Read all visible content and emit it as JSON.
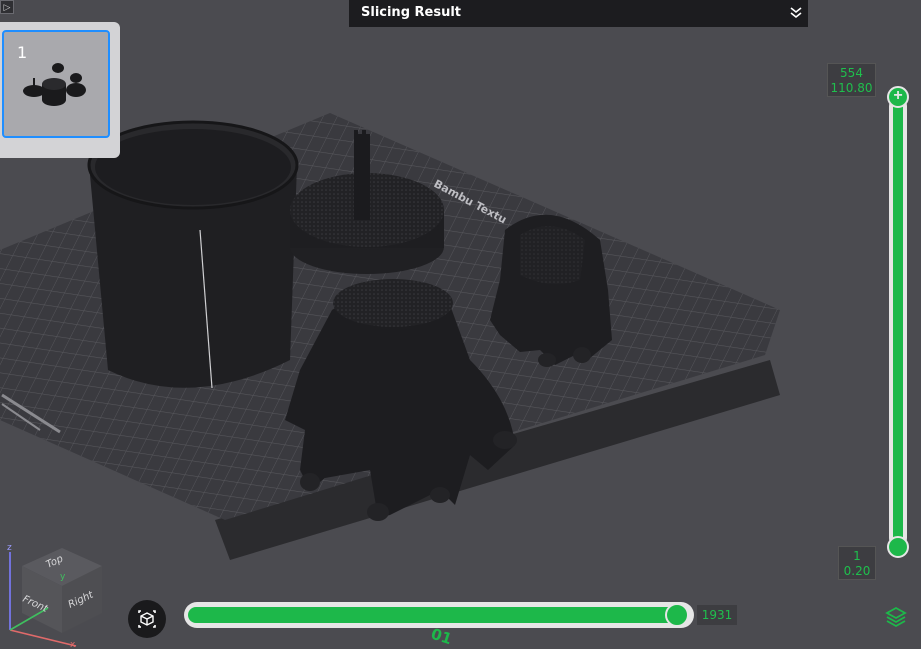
{
  "top_bar": {
    "title": "Slicing Result"
  },
  "plate": {
    "number": "1"
  },
  "bed": {
    "label": "Bambu Textu",
    "bottom_marker": "01"
  },
  "vertical_slider": {
    "top_layer": "554",
    "top_height": "110.80",
    "bottom_layer": "1",
    "bottom_height": "0.20"
  },
  "horizontal_slider": {
    "value": "1931"
  },
  "nav_cube": {
    "top": "Top",
    "front": "Front",
    "right": "Right",
    "axis_z": "z",
    "axis_y": "y",
    "axis_x": "x"
  },
  "colors": {
    "accent": "#1db84a",
    "selection": "#1f8eff",
    "bar_bg": "#1c1c1f"
  }
}
